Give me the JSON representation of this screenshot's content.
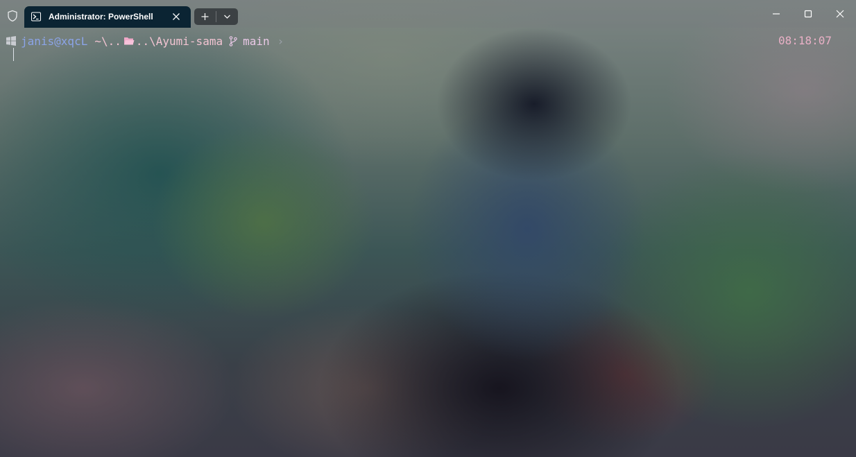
{
  "window": {
    "tab_title": "Administrator: PowerShell",
    "tab_icon": "powershell-icon",
    "shield_icon": "shield-icon",
    "caption_buttons": [
      "minimize-icon",
      "maximize-icon",
      "close-icon"
    ]
  },
  "prompt": {
    "user_host": "janis@xqcL",
    "path_prefix": "~\\..",
    "path_suffix": "..\\Ayumi-sama",
    "git_branch": "main",
    "prompt_symbol": "›",
    "time": "08:18:07"
  },
  "colors": {
    "tab_bg": "#0b2433",
    "user": "#8ba4e8",
    "path": "#f2c4d2",
    "folder_icon": "#f0a8c8",
    "branch": "#e9c8e6",
    "time": "#e9b0c6"
  }
}
